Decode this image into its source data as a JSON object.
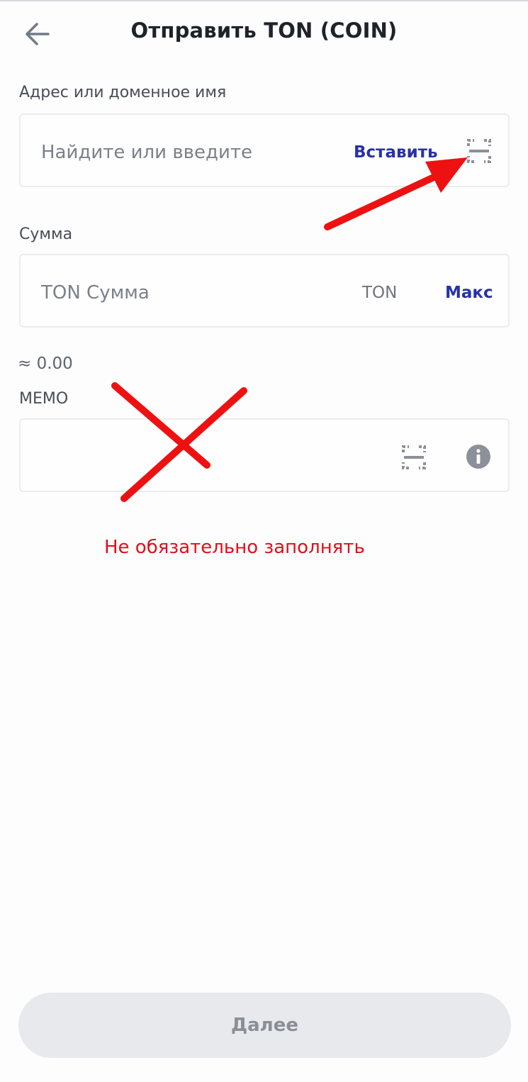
{
  "header": {
    "title": "Отправить TON (COIN)",
    "back_icon": "arrow-left-icon"
  },
  "address": {
    "label": "Адрес или доменное имя",
    "placeholder": "Найдите или введите",
    "paste_label": "Вставить",
    "scan_icon": "qr-scan-icon"
  },
  "amount": {
    "label": "Сумма",
    "placeholder": "TON Сумма",
    "unit": "TON",
    "max_label": "Макс",
    "approx_value": "≈ 0.00"
  },
  "memo": {
    "label": "MEMO",
    "scan_icon": "qr-scan-icon",
    "info_icon": "info-icon"
  },
  "annotation": {
    "note": "Не обязательно заполнять",
    "color": "#e0101a"
  },
  "footer": {
    "next_label": "Далее"
  },
  "colors": {
    "accent": "#2731a8",
    "text": "#1e2329",
    "muted": "#7b8089",
    "button_bg": "#e8e9ec",
    "border": "#ececef"
  }
}
